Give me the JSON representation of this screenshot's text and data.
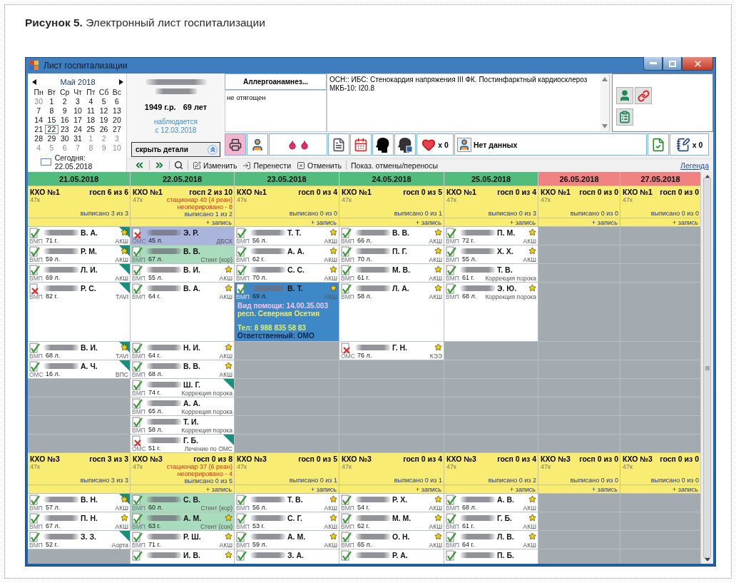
{
  "caption": "**Рисунок 5.** Электронный лист госпитализации",
  "window": {
    "title": "Лист госпитализации"
  },
  "calendar": {
    "month": "Май 2018",
    "weekdays": [
      "Пн",
      "Вт",
      "Ср",
      "Чт",
      "Пт",
      "Сб",
      "Вс"
    ],
    "weeks": [
      [
        {
          "day": "30",
          "muted": true,
          "selected": false
        },
        {
          "day": "1",
          "muted": false,
          "selected": false
        },
        {
          "day": "2",
          "muted": false,
          "selected": false
        },
        {
          "day": "3",
          "muted": false,
          "selected": false
        },
        {
          "day": "4",
          "muted": false,
          "selected": false
        },
        {
          "day": "5",
          "muted": false,
          "selected": false
        },
        {
          "day": "6",
          "muted": false,
          "selected": false
        }
      ],
      [
        {
          "day": "7",
          "muted": false,
          "selected": false
        },
        {
          "day": "8",
          "muted": false,
          "selected": false
        },
        {
          "day": "9",
          "muted": false,
          "selected": false
        },
        {
          "day": "10",
          "muted": false,
          "selected": false
        },
        {
          "day": "11",
          "muted": false,
          "selected": false
        },
        {
          "day": "12",
          "muted": false,
          "selected": false
        },
        {
          "day": "13",
          "muted": false,
          "selected": false
        }
      ],
      [
        {
          "day": "14",
          "muted": false,
          "selected": false
        },
        {
          "day": "15",
          "muted": false,
          "selected": false
        },
        {
          "day": "16",
          "muted": false,
          "selected": false
        },
        {
          "day": "17",
          "muted": false,
          "selected": false
        },
        {
          "day": "18",
          "muted": false,
          "selected": false
        },
        {
          "day": "19",
          "muted": false,
          "selected": false
        },
        {
          "day": "20",
          "muted": false,
          "selected": false
        }
      ],
      [
        {
          "day": "21",
          "muted": false,
          "selected": false
        },
        {
          "day": "22",
          "muted": false,
          "selected": true
        },
        {
          "day": "23",
          "muted": false,
          "selected": false
        },
        {
          "day": "24",
          "muted": false,
          "selected": false
        },
        {
          "day": "25",
          "muted": false,
          "selected": false
        },
        {
          "day": "26",
          "muted": false,
          "selected": false
        },
        {
          "day": "27",
          "muted": false,
          "selected": false
        }
      ],
      [
        {
          "day": "28",
          "muted": false,
          "selected": false
        },
        {
          "day": "29",
          "muted": false,
          "selected": false
        },
        {
          "day": "30",
          "muted": false,
          "selected": false
        },
        {
          "day": "31",
          "muted": false,
          "selected": false
        },
        {
          "day": "1",
          "muted": true,
          "selected": false
        },
        {
          "day": "2",
          "muted": true,
          "selected": false
        },
        {
          "day": "3",
          "muted": true,
          "selected": false
        }
      ],
      [
        {
          "day": "4",
          "muted": true,
          "selected": false
        },
        {
          "day": "5",
          "muted": true,
          "selected": false
        },
        {
          "day": "6",
          "muted": true,
          "selected": false
        },
        {
          "day": "7",
          "muted": true,
          "selected": false
        },
        {
          "day": "8",
          "muted": true,
          "selected": false
        },
        {
          "day": "9",
          "muted": true,
          "selected": false
        },
        {
          "day": "10",
          "muted": true,
          "selected": false
        }
      ]
    ],
    "today": "Сегодня: 22.05.2018"
  },
  "patient": {
    "birth": "1949 г.р.",
    "age": "69 лет",
    "observed": "наблюдается",
    "since": "с 12.03.2018",
    "toggle": "скрыть детали"
  },
  "allergy": {
    "button": "Аллергоанамнез...",
    "text": "не отягощен"
  },
  "diagnosis": "ОСН:: ИБС: Стенокардия напряжения III ФК. Постинфарктный кардиосклероз МКБ-10: I20.8",
  "icon_bar": {
    "heart_count": "x 0",
    "status": "Нет данных",
    "notes_count": "x 0"
  },
  "toolbar": {
    "edit": "Изменить",
    "move": "Перенести",
    "cancel": "Отменить",
    "show_cancelled": "Показ. отмены/переносы",
    "legend": "Легенда"
  },
  "dates": [
    {
      "label": "21.05.2018",
      "weekend": false
    },
    {
      "label": "22.05.2018",
      "weekend": false
    },
    {
      "label": "23.05.2018",
      "weekend": false
    },
    {
      "label": "24.05.2018",
      "weekend": false
    },
    {
      "label": "25.05.2018",
      "weekend": false
    },
    {
      "label": "26.05.2018",
      "weekend": true
    },
    {
      "label": "27.05.2018",
      "weekend": true
    }
  ],
  "sections": [
    {
      "days": [
        {
          "unit": "КХО №1",
          "beds": "госп 6 из 6",
          "room": "47к",
          "discharged": "выписано 3 из 3",
          "patients": [
            {
              "initials": "В. А.",
              "age": "71 г.",
              "funding": "ВМП",
              "procedure": "АКШ",
              "confirmed": true,
              "starred": true,
              "flagged": true
            },
            {
              "initials": "Р. М.",
              "age": "59 л.",
              "funding": "ВМП",
              "procedure": "АКШ",
              "confirmed": true,
              "starred": true,
              "flagged": true
            },
            {
              "initials": "Л. И.",
              "age": "69 л.",
              "funding": "ВМП",
              "procedure": "АКШ",
              "confirmed": true,
              "starred": false,
              "flagged": true
            },
            {
              "initials": "Р. С.",
              "age": "82 г.",
              "funding": "ВМП",
              "procedure": "TAVI",
              "confirmed": false,
              "starred": false,
              "flagged": true
            },
            {
              "initials": "В. И.",
              "age": "68 л.",
              "funding": "ВМП",
              "procedure": "TAVI",
              "confirmed": true,
              "starred": true,
              "flagged": true
            },
            {
              "initials": "А. Ч.",
              "age": "16 л.",
              "funding": "ОМС",
              "procedure": "ВПС",
              "confirmed": true,
              "starred": false,
              "flagged": true
            }
          ]
        },
        {
          "unit": "КХО №1",
          "beds": "госп 2 из 10",
          "room": "47к",
          "inpatient": "стационар 40 (4 реан)",
          "unoperated": "неоперировано - 8",
          "discharged": "выписано 1 из 2",
          "add": "+ запись",
          "patients": [
            {
              "initials": "Э. Р.",
              "age": "45 л.",
              "funding": "ОМС",
              "procedure": "ДБСХ",
              "confirmed": false,
              "starred": false,
              "flagged": false,
              "color": "#aab5dd"
            },
            {
              "initials": "В. В.",
              "age": "67 л.",
              "funding": "ВМП",
              "procedure": "Стент (кор)",
              "confirmed": true,
              "starred": false,
              "flagged": false,
              "color": "#a9dbbd"
            },
            {
              "initials": "В. И.",
              "age": "55 л.",
              "funding": "ВМП",
              "procedure": "АКШ",
              "confirmed": true,
              "starred": true,
              "flagged": false
            },
            {
              "initials": "В. А.",
              "age": "64 г.",
              "funding": "ВМП",
              "procedure": "АКШ",
              "confirmed": true,
              "starred": true,
              "flagged": false
            },
            {
              "initials": "Н. И.",
              "age": "64 г.",
              "funding": "ВМП",
              "procedure": "АКШ",
              "confirmed": true,
              "starred": true,
              "flagged": false
            },
            {
              "initials": "В. В.",
              "age": "68 л.",
              "funding": "ВМП",
              "procedure": "АКШ",
              "confirmed": true,
              "starred": true,
              "flagged": false
            },
            {
              "initials": "Ш. Г.",
              "age": "74 г.",
              "funding": "ВМП",
              "procedure": "Коррекция порока",
              "confirmed": true,
              "starred": false,
              "flagged": true
            },
            {
              "initials": "А. А.",
              "age": "65 л.",
              "funding": "ВМП",
              "procedure": "Коррекция порока",
              "confirmed": true,
              "starred": false,
              "flagged": false
            },
            {
              "initials": "Т. И.",
              "age": "58 л.",
              "funding": "ВМП",
              "procedure": "Коррекция порока",
              "confirmed": true,
              "starred": false,
              "flagged": false
            },
            {
              "initials": "Г. Б.",
              "age": "51 г.",
              "funding": "ОМС",
              "procedure": "Лечение по ОМС",
              "confirmed": false,
              "starred": false,
              "flagged": true
            }
          ]
        },
        {
          "unit": "КХО №1",
          "beds": "госп 0 из 4",
          "room": "47к",
          "discharged": "выписано 0 из 0",
          "add": "+ запись",
          "patients": [
            {
              "initials": "Т. Т.",
              "age": "56 л.",
              "funding": "ВМП",
              "procedure": "АКШ",
              "confirmed": true,
              "starred": true,
              "flagged": false
            },
            {
              "initials": "А. А.",
              "age": "62 г.",
              "funding": "ВМП",
              "procedure": "АКШ",
              "confirmed": true,
              "starred": true,
              "flagged": false
            },
            {
              "initials": "С. С.",
              "age": "70 л.",
              "funding": "ВМП",
              "procedure": "АКШ",
              "confirmed": true,
              "starred": true,
              "flagged": false
            },
            {
              "initials": "В. Т.",
              "age": "69 л.",
              "funding": "ВМП",
              "procedure": "АКШ",
              "confirmed": true,
              "starred": true,
              "flagged": false,
              "color": "#3f88c8",
              "details": [
                [
                  {
                    "text": "Вид помощи: 14.00.35.003",
                    "color": "#f2c6ec"
                  },
                  {
                    "text": "респ. Северная Осетия",
                    "color": "#f4ea5a"
                  }
                ],
                [
                  {
                    "text": "Тел: 8 988 835 58 83",
                    "color": "#d9f06c"
                  },
                  {
                    "text": "Ответственный: ОМО",
                    "color": "#15233f"
                  }
                ]
              ]
            }
          ]
        },
        {
          "unit": "КХО №1",
          "beds": "госп 0 из 5",
          "room": "47к",
          "discharged": "выписано 0 из 1",
          "add": "+ запись",
          "patients": [
            {
              "initials": "В. В.",
              "age": "66 л.",
              "funding": "ВМП",
              "procedure": "АКШ",
              "confirmed": true,
              "starred": true,
              "flagged": false
            },
            {
              "initials": "П. Г.",
              "age": "70 л.",
              "funding": "ВМП",
              "procedure": "АКШ",
              "confirmed": true,
              "starred": true,
              "flagged": false
            },
            {
              "initials": "М. В.",
              "age": "61 г.",
              "funding": "ВМП",
              "procedure": "АКШ",
              "confirmed": true,
              "starred": true,
              "flagged": false
            },
            {
              "initials": "Л. А.",
              "age": "58 л.",
              "funding": "ВМП",
              "procedure": "АКШ",
              "confirmed": true,
              "starred": true,
              "flagged": false
            },
            {
              "initials": "Г. Н.",
              "age": "76 л.",
              "funding": "ОМС",
              "procedure": "КЭЭ",
              "confirmed": false,
              "starred": true,
              "flagged": false
            }
          ]
        },
        {
          "unit": "КХО №1",
          "beds": "госп 0 из 4",
          "room": "47к",
          "discharged": "выписано 0 из 3",
          "add": "+ запись",
          "patients": [
            {
              "initials": "П. М.",
              "age": "72 г.",
              "funding": "ВМП",
              "procedure": "АКШ",
              "confirmed": true,
              "starred": true,
              "flagged": false
            },
            {
              "initials": "Х. Х.",
              "age": "55 л.",
              "funding": "ВМП",
              "procedure": "АКШ",
              "confirmed": true,
              "starred": true,
              "flagged": false
            },
            {
              "initials": "Т. В.",
              "age": "61 г.",
              "funding": "ВМП",
              "procedure": "Коррекция порока",
              "confirmed": true,
              "starred": false,
              "flagged": false
            },
            {
              "initials": "Э. Ю.",
              "age": "68 л.",
              "funding": "ВМП",
              "procedure": "Коррекция порока",
              "confirmed": true,
              "starred": true,
              "flagged": false
            }
          ]
        },
        {
          "unit": "КХО №1",
          "beds": "госп 0 из 0",
          "room": "47к",
          "discharged": "выписано 0 из 0",
          "add": "+ запись"
        },
        {
          "unit": "КХО №1",
          "beds": "госп 0 из 0",
          "room": "47к",
          "discharged": "выписано 0 из 0",
          "add": "+ запись"
        }
      ]
    },
    {
      "days": [
        {
          "unit": "КХО №3",
          "beds": "госп 3 из 3",
          "room": "47к",
          "discharged": "выписано 3 из 3",
          "patients": [
            {
              "initials": "В. Н.",
              "age": "57 л.",
              "funding": "ВМП",
              "procedure": "АКШ",
              "confirmed": true,
              "starred": true,
              "flagged": true
            },
            {
              "initials": "П. Н.",
              "age": "67 л.",
              "funding": "ВМП",
              "procedure": "АКШ",
              "confirmed": true,
              "starred": true,
              "flagged": false
            },
            {
              "initials": "З. З.",
              "age": "52 г.",
              "funding": "ВМП",
              "procedure": "Аорта",
              "confirmed": true,
              "starred": false,
              "flagged": true
            }
          ]
        },
        {
          "unit": "КХО №3",
          "beds": "госп 0 из 8",
          "room": "47к",
          "inpatient": "стационар 37 (6 реан)",
          "unoperated": "неоперировано - 4",
          "discharged": "выписано 0 из 5",
          "add": "+ запись",
          "patients": [
            {
              "initials": "С. В.",
              "age": "60 л.",
              "funding": "ВМП",
              "procedure": "Стент (кор)",
              "confirmed": true,
              "starred": false,
              "flagged": false,
              "color": "#a9dbbd"
            },
            {
              "initials": "А. М.",
              "age": "63 г.",
              "funding": "ВМП",
              "procedure": "Стент (сон)",
              "confirmed": true,
              "starred": true,
              "flagged": false,
              "color": "#a9dbbd"
            },
            {
              "initials": "Р. Ш.",
              "age": "71 г.",
              "funding": "ВМП",
              "procedure": "АКШ",
              "confirmed": true,
              "starred": true,
              "flagged": false
            },
            {
              "initials": "И. В.",
              "confirmed": true,
              "starred": true,
              "flagged": false
            }
          ]
        },
        {
          "unit": "КХО №3",
          "beds": "госп 0 из 5",
          "room": "47к",
          "discharged": "выписано 0 из 1",
          "add": "+ запись",
          "patients": [
            {
              "initials": "Т. В.",
              "age": "56 л.",
              "funding": "ВМП",
              "procedure": "АКШ",
              "confirmed": true,
              "starred": true,
              "flagged": false
            },
            {
              "initials": "С. Г.",
              "age": "53 г.",
              "funding": "ВМП",
              "procedure": "АКШ",
              "confirmed": true,
              "starred": true,
              "flagged": false
            },
            {
              "initials": "А. М.",
              "age": "59 л.",
              "funding": "ВМП",
              "procedure": "АКШ",
              "confirmed": true,
              "starred": true,
              "flagged": false
            },
            {
              "initials": "З. А.",
              "confirmed": true,
              "starred": false,
              "flagged": false
            }
          ]
        },
        {
          "unit": "КХО №3",
          "beds": "госп 0 из 4",
          "room": "47к",
          "discharged": "выписано 0 из 1",
          "add": "+ запись",
          "patients": [
            {
              "initials": "Р. Х.",
              "age": "54 г.",
              "funding": "ВМП",
              "procedure": "АКШ",
              "confirmed": true,
              "starred": true,
              "flagged": false
            },
            {
              "initials": "М. М.",
              "age": "62 г.",
              "funding": "ВМП",
              "procedure": "АКШ",
              "confirmed": true,
              "starred": true,
              "flagged": false
            },
            {
              "initials": "О. Н.",
              "age": "65 л.",
              "funding": "ВМП",
              "procedure": "АКШ",
              "confirmed": true,
              "starred": true,
              "flagged": false
            },
            {
              "initials": "Р. А.",
              "confirmed": true,
              "starred": false,
              "flagged": false
            }
          ]
        },
        {
          "unit": "КХО №3",
          "beds": "госп 0 из 4",
          "room": "47к",
          "discharged": "выписано 0 из 2",
          "add": "+ запись",
          "patients": [
            {
              "initials": "А. В.",
              "age": "68 л.",
              "funding": "ВМП",
              "procedure": "АКШ",
              "confirmed": true,
              "starred": true,
              "flagged": false
            },
            {
              "initials": "Г. Б.",
              "age": "61 г.",
              "funding": "ВМП",
              "procedure": "АКШ",
              "confirmed": true,
              "starred": true,
              "flagged": false
            },
            {
              "initials": "Л. В.",
              "age": "64 г.",
              "funding": "ВМП",
              "procedure": "АКШ",
              "confirmed": true,
              "starred": true,
              "flagged": false
            },
            {
              "initials": "П. Б.",
              "confirmed": true,
              "starred": false,
              "flagged": false
            }
          ]
        },
        {
          "unit": "КХО №3",
          "beds": "госп 0 из 0",
          "room": "47к",
          "discharged": "выписано 0 из 0",
          "add": "+ запись"
        },
        {
          "unit": "КХО №3",
          "beds": "госп 0 из 0",
          "room": "47к",
          "discharged": "выписано 0 из 0",
          "add": "+ запись"
        }
      ]
    }
  ]
}
